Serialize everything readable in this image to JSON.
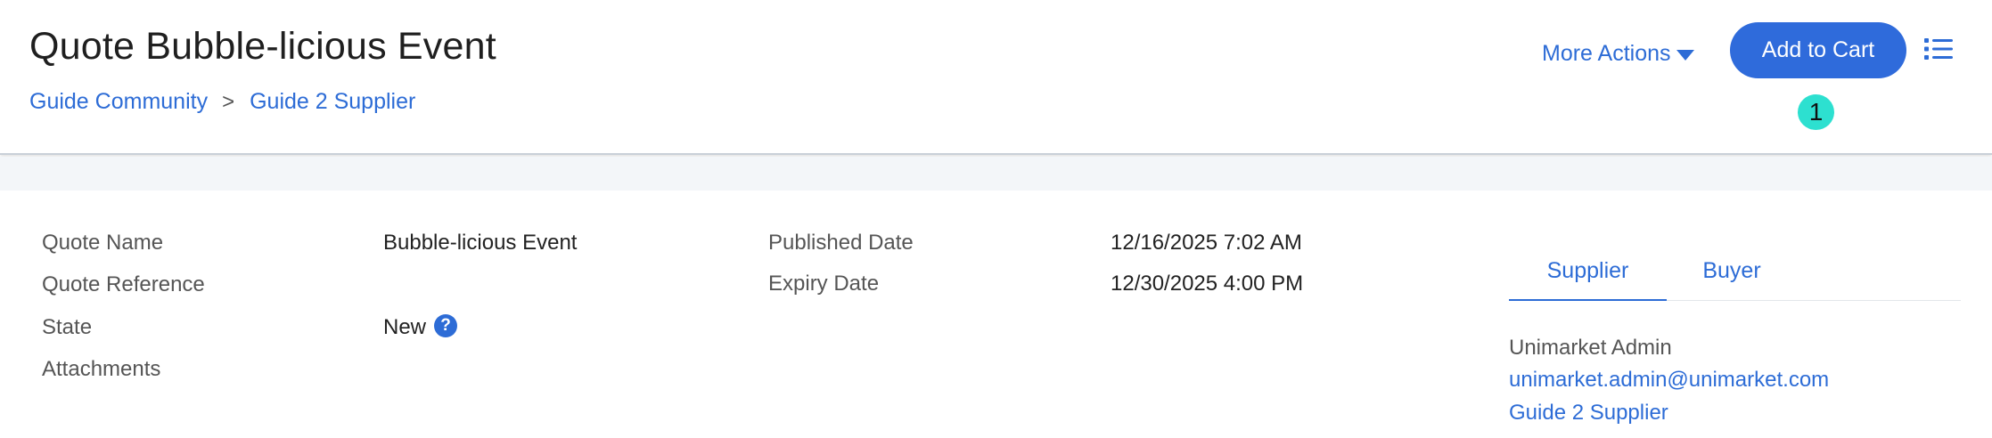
{
  "header": {
    "title": "Quote Bubble-licious Event",
    "breadcrumb": [
      {
        "label": "Guide Community"
      },
      {
        "label": "Guide 2 Supplier"
      }
    ],
    "breadcrumb_separator": ">",
    "more_actions_label": "More Actions",
    "add_to_cart_label": "Add to Cart",
    "badge_count": "1",
    "icons": {
      "more_actions": "caret-down-icon",
      "menu": "list-icon"
    }
  },
  "details": {
    "left": [
      {
        "label": "Quote Name",
        "value": "Bubble-licious Event"
      },
      {
        "label": "Quote Reference",
        "value": ""
      },
      {
        "label": "State",
        "value": "New"
      },
      {
        "label": "Attachments",
        "value": ""
      }
    ],
    "middle": [
      {
        "label": "Published Date",
        "value": "12/16/2025 7:02 AM"
      },
      {
        "label": "Expiry Date",
        "value": "12/30/2025 4:00 PM"
      }
    ],
    "state_help_icon": "question-icon",
    "state_help_symbol": "?"
  },
  "contact": {
    "tabs": [
      {
        "label": "Supplier",
        "active": true
      },
      {
        "label": "Buyer",
        "active": false
      }
    ],
    "name": "Unimarket Admin",
    "email": "unimarket.admin@unimarket.com",
    "organization": "Guide 2 Supplier"
  },
  "colors": {
    "accent": "#2d6cd6",
    "button": "#2f6bdb",
    "badge": "#2de0d0",
    "band": "#f3f6f9"
  }
}
